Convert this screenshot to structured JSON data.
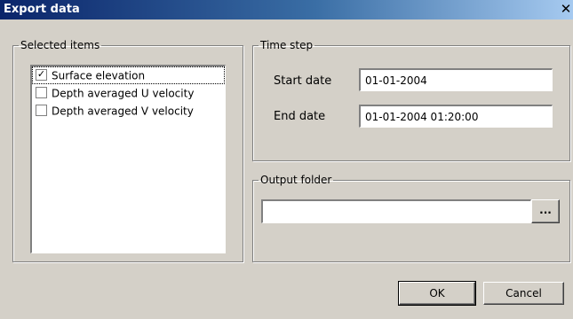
{
  "window": {
    "title": "Export data",
    "close_glyph": "✕"
  },
  "selected_items": {
    "legend": "Selected items",
    "items": [
      {
        "label": "Surface elevation",
        "checked": true,
        "check_glyph": "✓"
      },
      {
        "label": "Depth averaged U velocity",
        "checked": false,
        "check_glyph": ""
      },
      {
        "label": "Depth averaged V velocity",
        "checked": false,
        "check_glyph": ""
      }
    ]
  },
  "time_step": {
    "legend": "Time step",
    "start_label": "Start date",
    "start_value": "01-01-2004",
    "end_label": "End date",
    "end_value": "01-01-2004 01:20:00"
  },
  "output_folder": {
    "legend": "Output folder",
    "value": "",
    "browse_label": "..."
  },
  "buttons": {
    "ok": "OK",
    "cancel": "Cancel"
  }
}
